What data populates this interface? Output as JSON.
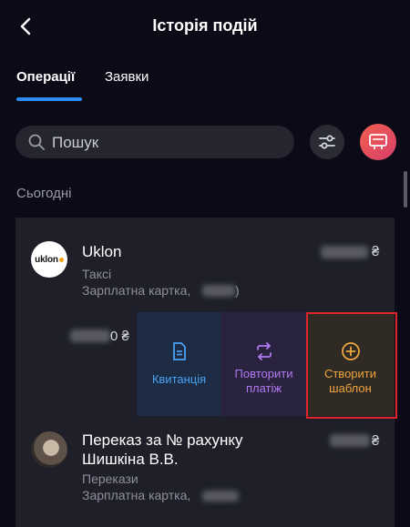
{
  "header": {
    "title": "Історія подій"
  },
  "tabs": [
    {
      "label": "Операції",
      "active": true
    },
    {
      "label": "Заявки",
      "active": false
    }
  ],
  "search": {
    "placeholder": "Пошук"
  },
  "section": {
    "label": "Сьогодні"
  },
  "transactions": [
    {
      "merchant": "Uklon",
      "logo_text": "uklon",
      "category": "Таксі",
      "card": "Зарплатна картка,",
      "card_suffix": ")",
      "currency": "₴"
    },
    {
      "merchant_line1": "Переказ за № рахунку",
      "merchant_line2": "Шишкіна В.В.",
      "category": "Перекази",
      "card": "Зарплатна картка,",
      "currency": "₴"
    }
  ],
  "swipe": {
    "amount_suffix": "0 ₴",
    "actions": [
      {
        "label": "Квитанція",
        "icon": "document-icon",
        "color": "#4aa3f5"
      },
      {
        "label": "Повторити\nплатіж",
        "icon": "repeat-icon",
        "color": "#b07af0"
      },
      {
        "label": "Створити\nшаблон",
        "icon": "plus-circle-icon",
        "color": "#f0a53c"
      }
    ]
  },
  "colors": {
    "background": "#0b0b18",
    "accent": "#2d8cf0",
    "highlight": "#e0242b"
  }
}
